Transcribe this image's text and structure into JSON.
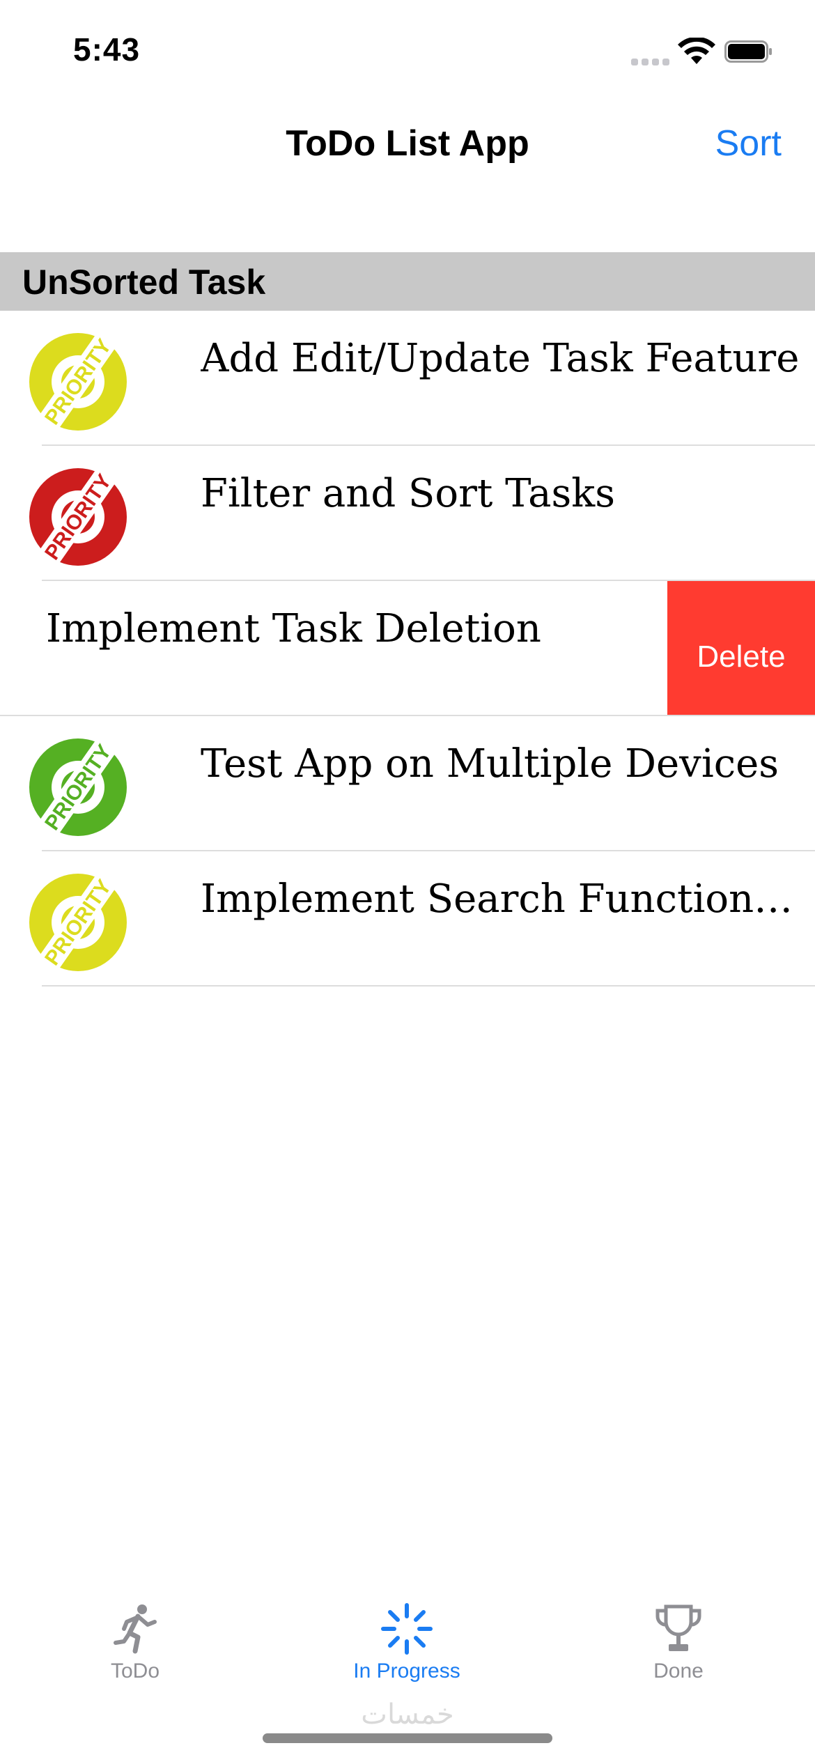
{
  "status_bar": {
    "time": "5:43"
  },
  "nav": {
    "title": "ToDo List App",
    "sort_label": "Sort"
  },
  "section": {
    "title": "UnSorted Task"
  },
  "tasks": [
    {
      "title": "Add Edit/Update Task Feature",
      "priority_color": "#dcdc1e",
      "badge_text": "PRIORITY"
    },
    {
      "title": "Filter and Sort Tasks",
      "priority_color": "#cc1d1d",
      "badge_text": "PRIORITY"
    },
    {
      "title": "Implement Task Deletion",
      "swiped": true,
      "delete_label": "Delete"
    },
    {
      "title": "Test App on Multiple Devices",
      "priority_color": "#55b023",
      "badge_text": "PRIORITY"
    },
    {
      "title": "Implement Search Functionality",
      "priority_color": "#dcdc1e",
      "badge_text": "PRIORITY"
    }
  ],
  "tabs": [
    {
      "label": "ToDo",
      "icon": "running-figure-icon",
      "active": false
    },
    {
      "label": "In Progress",
      "icon": "progress-spinner-icon",
      "active": true
    },
    {
      "label": "Done",
      "icon": "trophy-icon",
      "active": false
    }
  ],
  "watermark": "خمسات",
  "colors": {
    "accent": "#1a7cf2",
    "delete": "#ff3b30",
    "section_bg": "#c8c8c8"
  }
}
